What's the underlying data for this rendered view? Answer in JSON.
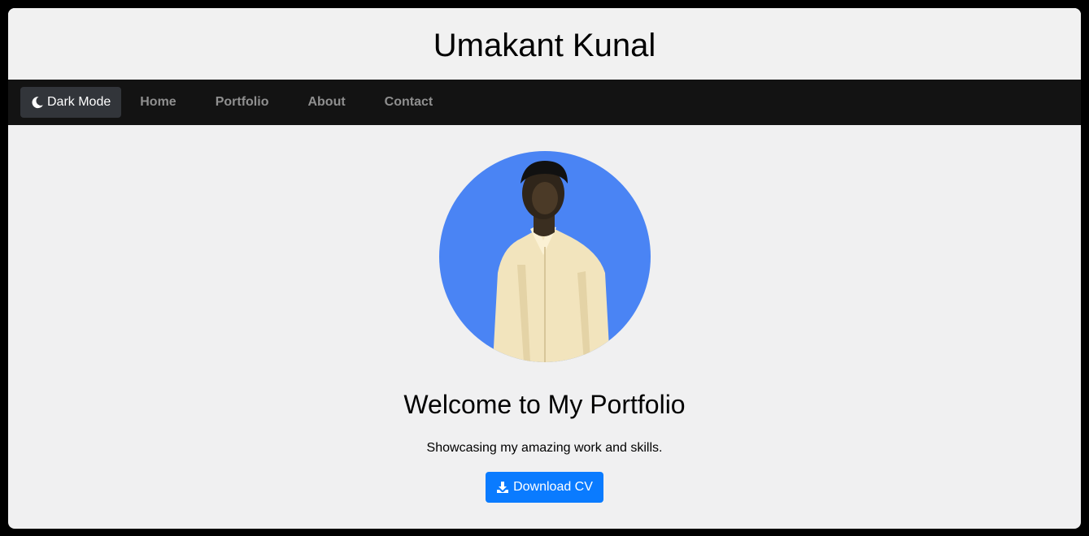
{
  "header": {
    "title": "Umakant Kunal"
  },
  "nav": {
    "dark_mode_label": "Dark Mode",
    "dark_mode_icon": "moon-icon",
    "links": [
      {
        "label": "Home"
      },
      {
        "label": "Portfolio"
      },
      {
        "label": "About"
      },
      {
        "label": "Contact"
      }
    ]
  },
  "hero": {
    "avatar_alt": "profile photo",
    "heading": "Welcome to My Portfolio",
    "tagline": "Showcasing my amazing work and skills.",
    "download_label": "Download CV",
    "download_icon": "download-icon"
  },
  "colors": {
    "page_background": "#f0f0f1",
    "navbar_background": "#131313",
    "avatar_background": "#4a84f4",
    "button_primary": "#0a7bff",
    "nav_link": "#8f8f8f"
  }
}
